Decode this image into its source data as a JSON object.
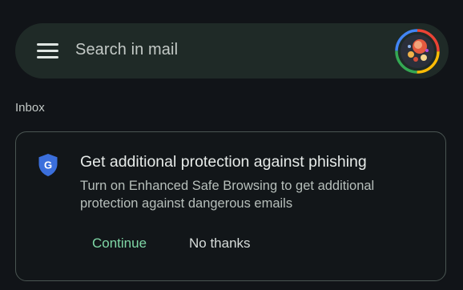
{
  "search": {
    "placeholder": "Search in mail",
    "menu_icon": "hamburger-menu-icon",
    "avatar_icon": "account-avatar"
  },
  "inbox": {
    "label": "Inbox"
  },
  "promo_card": {
    "icon": "google-shield-icon",
    "icon_letter": "G",
    "title": "Get additional protection against phishing",
    "body": "Turn on Enhanced Safe Browsing to get additional protection against dangerous emails",
    "continue_label": "Continue",
    "no_thanks_label": "No thanks"
  },
  "colors": {
    "background": "#111418",
    "search_bar": "#1f2a27",
    "accent_green": "#7fd7a6",
    "shield_blue": "#3b6fdc",
    "card_border": "#4a5552"
  }
}
